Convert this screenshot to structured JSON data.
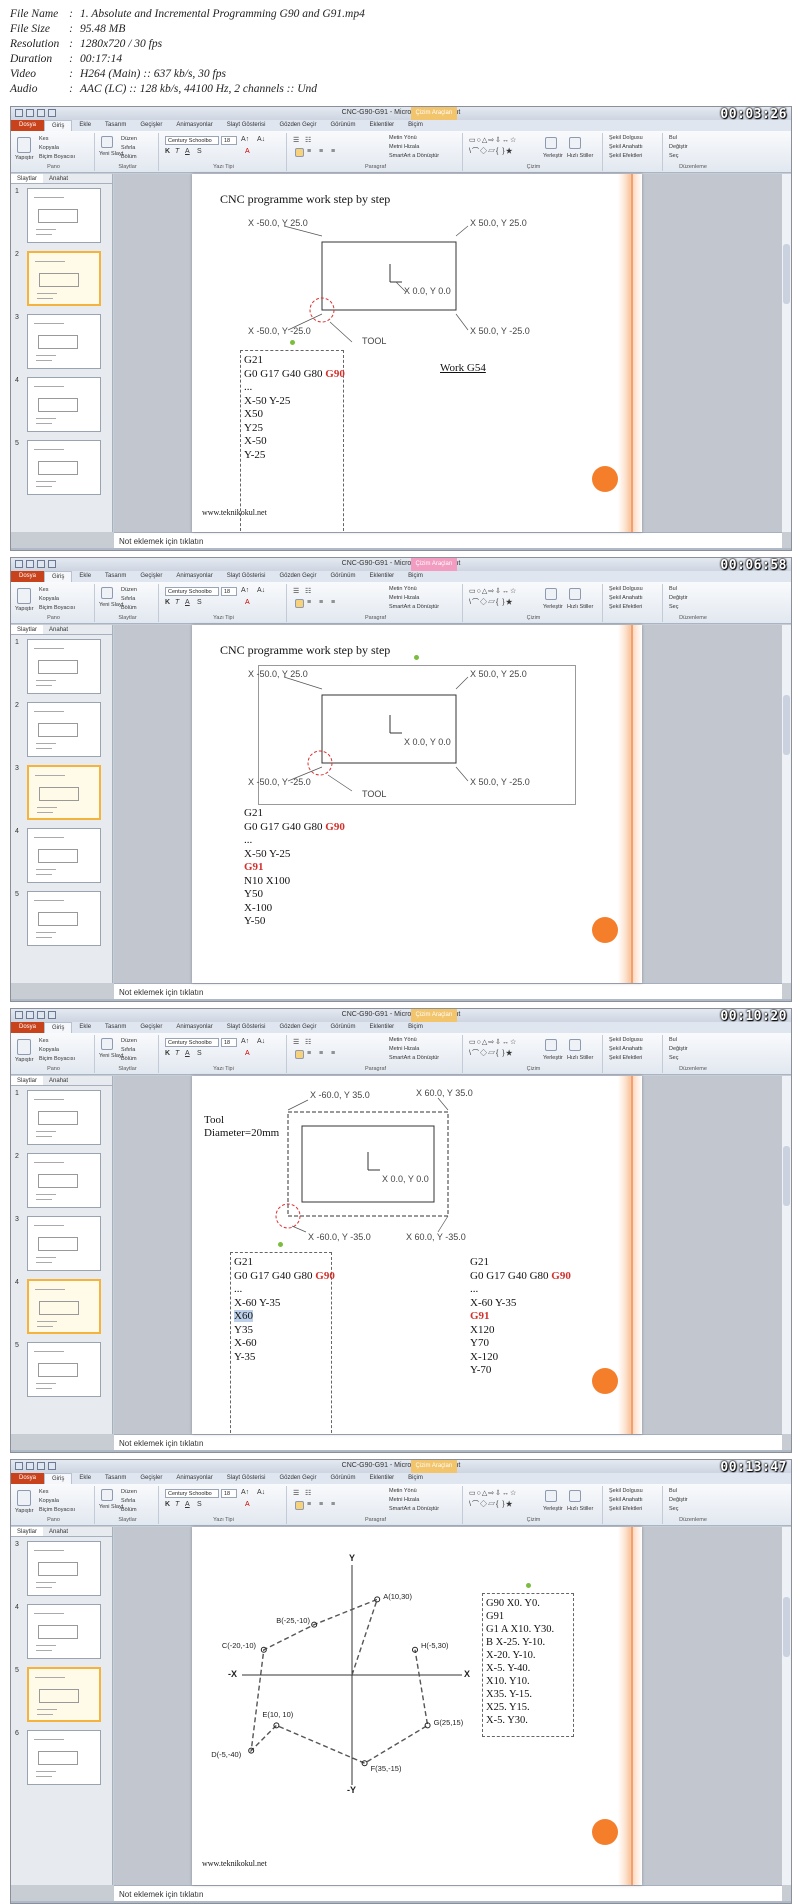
{
  "file_info": [
    {
      "key": "File Name",
      "value": "1. Absolute and Incremental Programming G90 and G91.mp4"
    },
    {
      "key": "File Size",
      "value": "95.48 MB"
    },
    {
      "key": "Resolution",
      "value": "1280x720 / 30 fps"
    },
    {
      "key": "Duration",
      "value": "00:17:14"
    },
    {
      "key": "Video",
      "value": "H264 (Main) :: 637 kb/s, 30 fps"
    },
    {
      "key": "Audio",
      "value": "AAC (LC) :: 128 kb/s, 44100 Hz, 2 channels :: Und"
    }
  ],
  "app": {
    "window_title": "CNC-G90-G91 - Microsoft PowerPoint",
    "context_tab_drawing": "Çizim Araçları",
    "context_tab_format": "Biçim",
    "tabs": [
      "Dosya",
      "Giriş",
      "Ekle",
      "Tasarım",
      "Geçişler",
      "Animasyonlar",
      "Slayt Gösterisi",
      "Gözden Geçir",
      "Görünüm",
      "Eklentiler",
      "Biçim"
    ],
    "ribbon": {
      "paste": "Yapıştır",
      "cut": "Kes",
      "copy": "Kopyala",
      "format_painter": "Biçim Boyacısı",
      "clipboard": "Pano",
      "new_slide": "Yeni Slayt",
      "layout": "Düzen",
      "reset": "Sıfırla",
      "section": "Bölüm",
      "slides_group": "Slaytlar",
      "font_name": "Century Schoolbo",
      "font_size": "18",
      "font_group": "Yazı Tipi",
      "text_direction": "Metin Yönü",
      "align_text": "Metni Hizala",
      "smartart": "SmartArt a Dönüştür",
      "paragraph_group": "Paragraf",
      "arrange": "Yerleştir",
      "quick_styles": "Hızlı Stiller",
      "drawing_group": "Çizim",
      "shape_fill": "Şekil Dolgusu",
      "shape_outline": "Şekil Anahattı",
      "shape_effects": "Şekil Efektleri",
      "find": "Bul",
      "replace": "Değiştir",
      "select": "Seç",
      "editing_group": "Düzenleme"
    },
    "pane_tabs": [
      "Slaytlar",
      "Anahat"
    ],
    "notes_placeholder": "Not eklemek için tıklatın",
    "website": "www.teknikokul.net"
  },
  "frames": [
    {
      "timecode": "00:03:26",
      "title": "CNC programme work step by step",
      "coords": {
        "tl": "X -50.0, Y 25.0",
        "tr": "X 50.0, Y 25.0",
        "bl": "X -50.0, Y -25.0",
        "br": "X 50.0, Y -25.0",
        "center": "X 0.0, Y 0.0"
      },
      "tool_label": "TOOL",
      "work_label": "Work G54",
      "code": [
        "G21",
        "G0 G17 G40 G80",
        "...",
        "X-50 Y-25",
        "X50",
        "Y25",
        "X-50",
        "Y-25"
      ],
      "code_g": "G90",
      "thumbs": [
        "1",
        "2",
        "3",
        "4",
        "5"
      ]
    },
    {
      "timecode": "00:06:58",
      "title": "CNC programme work step by step",
      "coords": {
        "tl": "X -50.0, Y 25.0",
        "tr": "X 50.0, Y 25.0",
        "bl": "X -50.0, Y -25.0",
        "br": "X 50.0, Y -25.0",
        "center": "X 0.0, Y 0.0"
      },
      "tool_label": "TOOL",
      "code": [
        "G21",
        "G0 G17 G40 G80",
        "...",
        "X-50 Y-25"
      ],
      "code_g": "G90",
      "code_g2": "G91",
      "code2": [
        "N10 X100",
        "Y50",
        "X-100",
        "Y-50"
      ],
      "thumbs": [
        "1",
        "2",
        "3",
        "4",
        "5"
      ]
    },
    {
      "timecode": "00:10:20",
      "tool_label": "Tool",
      "tool_diameter": "Diameter=20mm",
      "coords": {
        "tl": "X -60.0, Y 35.0",
        "tr": "X 60.0, Y 35.0",
        "bl": "X -60.0, Y -35.0",
        "br": "X 60.0, Y -35.0",
        "center": "X 0.0, Y 0.0"
      },
      "code_left": [
        "G21",
        "G0 G17 G40 G80",
        "...",
        "X-60 Y-35",
        "X60",
        "Y35",
        "X-60",
        "Y-35"
      ],
      "code_left_g": "G90",
      "code_right": [
        "G21",
        "G0 G17 G40 G80",
        "...",
        "X-60 Y-35"
      ],
      "code_right_g": "G90",
      "code_right_g2": "G91",
      "code_right2": [
        "X120",
        "Y70",
        "X-120",
        "Y-70"
      ],
      "thumbs": [
        "1",
        "2",
        "3",
        "4",
        "5"
      ]
    },
    {
      "timecode": "00:13:47",
      "points": [
        {
          "label": "A(10,30)"
        },
        {
          "label": "B(-25,-10)"
        },
        {
          "label": "C(-20,-10)"
        },
        {
          "label": "D(-5,-40)"
        },
        {
          "label": "E(10, 10)"
        },
        {
          "label": "F(35,-15)"
        },
        {
          "label": "G(25,15)"
        },
        {
          "label": "H(-5,30)"
        }
      ],
      "axis": {
        "x": "X",
        "neg_x": "-X",
        "y": "Y",
        "neg_y": "-Y"
      },
      "code": [
        "G90 X0. Y0.",
        "G91",
        "G1 A X10. Y30.",
        "B X-25. Y-10.",
        "X-20. Y-10.",
        "X-5. Y-40.",
        "X10. Y10.",
        "X35. Y-15.",
        "X25. Y15.",
        "X-5. Y30."
      ],
      "thumbs": [
        "3",
        "4",
        "5",
        "6"
      ]
    }
  ]
}
